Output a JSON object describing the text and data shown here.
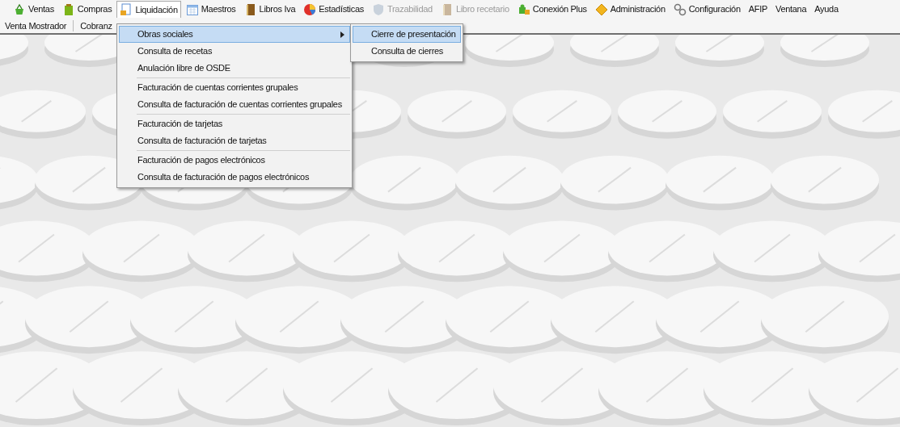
{
  "menu_bar": [
    {
      "label": "Ventas",
      "kind": "basket",
      "selected": false,
      "disabled": false
    },
    {
      "label": "Compras",
      "kind": "bag",
      "selected": false,
      "disabled": false
    },
    {
      "label": "Liquidación",
      "kind": "document",
      "selected": true,
      "disabled": false
    },
    {
      "label": "Maestros",
      "kind": "calendar",
      "selected": false,
      "disabled": false
    },
    {
      "label": "Libros Iva",
      "kind": "book",
      "selected": false,
      "disabled": false
    },
    {
      "label": "Estadísticas",
      "kind": "pie",
      "selected": false,
      "disabled": false
    },
    {
      "label": "Trazabilidad",
      "kind": "shield",
      "selected": false,
      "disabled": true
    },
    {
      "label": "Libro recetario",
      "kind": "book",
      "selected": false,
      "disabled": true
    },
    {
      "label": "Conexión Plus",
      "kind": "puzzle",
      "selected": false,
      "disabled": false
    },
    {
      "label": "Administración",
      "kind": "diamond",
      "selected": false,
      "disabled": false
    },
    {
      "label": "Configuración",
      "kind": "gears",
      "selected": false,
      "disabled": false
    },
    {
      "label": "AFIP",
      "kind": "text",
      "selected": false,
      "disabled": false
    },
    {
      "label": "Ventana",
      "kind": "text",
      "selected": false,
      "disabled": false
    },
    {
      "label": "Ayuda",
      "kind": "text",
      "selected": false,
      "disabled": false
    }
  ],
  "toolbar": [
    "Venta Mostrador",
    "Cobranz"
  ],
  "dropdown": {
    "groups": [
      [
        {
          "label": "Obras sociales",
          "has_submenu": true,
          "selected": true
        },
        {
          "label": "Consulta de recetas",
          "has_submenu": false,
          "selected": false
        },
        {
          "label": "Anulación libre de OSDE",
          "has_submenu": false,
          "selected": false
        }
      ],
      [
        {
          "label": "Facturación de cuentas corrientes grupales",
          "has_submenu": false,
          "selected": false
        },
        {
          "label": "Consulta de facturación de cuentas corrientes grupales",
          "has_submenu": false,
          "selected": false
        }
      ],
      [
        {
          "label": "Facturación de tarjetas",
          "has_submenu": false,
          "selected": false
        },
        {
          "label": "Consulta de facturación de tarjetas",
          "has_submenu": false,
          "selected": false
        }
      ],
      [
        {
          "label": "Facturación de pagos electrónicos",
          "has_submenu": false,
          "selected": false
        },
        {
          "label": "Consulta de facturación de pagos electrónicos",
          "has_submenu": false,
          "selected": false
        }
      ]
    ]
  },
  "submenu": [
    {
      "label": "Cierre de presentación",
      "selected": true
    },
    {
      "label": "Consulta de cierres",
      "selected": false
    }
  ]
}
